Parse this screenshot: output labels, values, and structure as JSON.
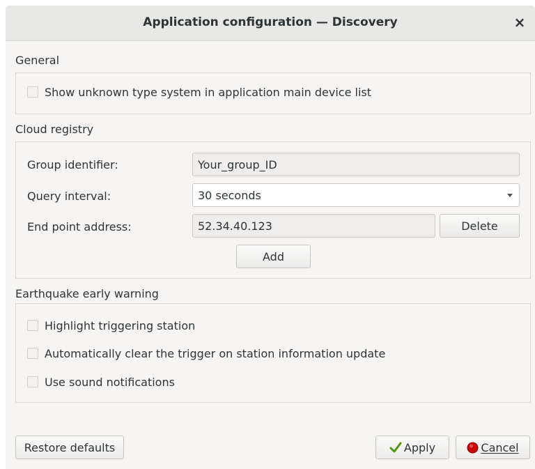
{
  "window": {
    "title": "Application configuration — Discovery",
    "close_glyph": "×"
  },
  "general": {
    "heading": "General",
    "show_unknown_label": "Show unknown type system in application main device list"
  },
  "cloud_registry": {
    "heading": "Cloud registry",
    "group_identifier_label": "Group identifier:",
    "group_identifier_value": "Your_group_ID",
    "query_interval_label": "Query interval:",
    "query_interval_value": "30 seconds",
    "end_point_label": "End point address:",
    "end_point_value": "52.34.40.123",
    "delete_label": "Delete",
    "add_label": "Add"
  },
  "earthquake": {
    "heading": "Earthquake early warning",
    "options": [
      "Highlight triggering station",
      "Automatically clear the trigger on station information update",
      "Use sound notifications"
    ]
  },
  "footer": {
    "restore_label": "Restore defaults",
    "apply_label": "Apply",
    "cancel_label": "Cancel",
    "apply_icon": "checkmark-icon",
    "cancel_icon": "red-stop-icon"
  },
  "colors": {
    "window_bg": "#f6f5f4",
    "titlebar_bg": "#e8e8e7",
    "frame_border": "#d8d6d2",
    "apply_check": "#4e9a06",
    "cancel_stop": "#cc0000"
  }
}
